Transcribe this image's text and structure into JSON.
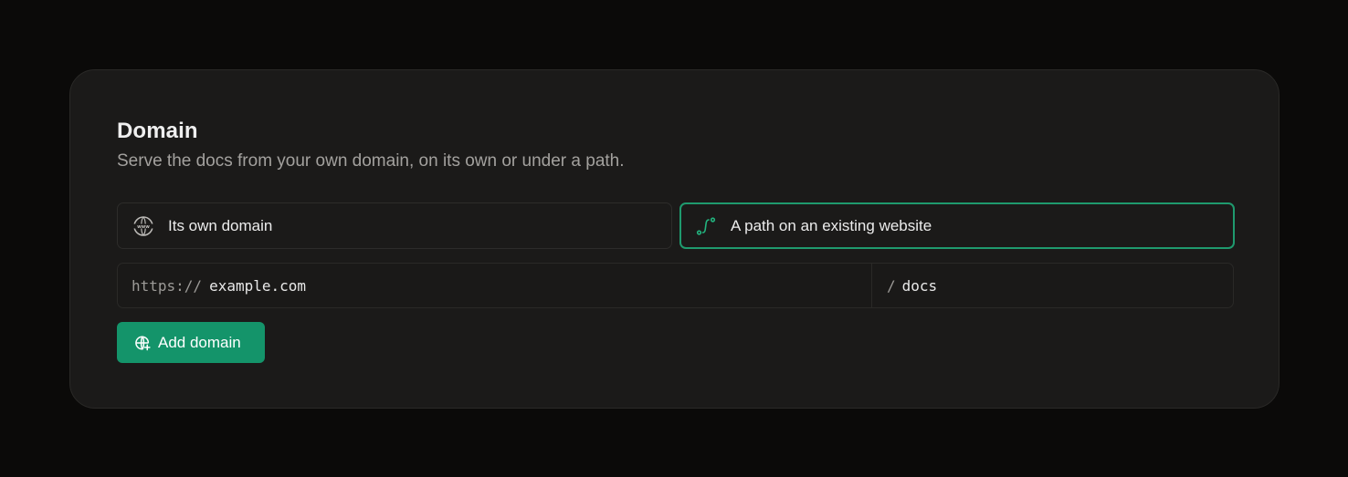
{
  "section": {
    "title": "Domain",
    "subtitle": "Serve the docs from your own domain, on its own or under a path."
  },
  "options": [
    {
      "label": "Its own domain",
      "icon": "www-globe-icon",
      "selected": false
    },
    {
      "label": "A path on an existing website",
      "icon": "path-route-icon",
      "selected": true
    }
  ],
  "url_input": {
    "prefix": "https://",
    "host_value": "example.com",
    "path_prefix": "/",
    "path_value": "docs"
  },
  "add_button": {
    "label": "Add domain",
    "icon": "globe-plus-icon"
  },
  "colors": {
    "accent": "#14946a",
    "selected_border": "#1f9a6e",
    "card_bg": "#1b1a19",
    "page_bg": "#0b0a09"
  }
}
